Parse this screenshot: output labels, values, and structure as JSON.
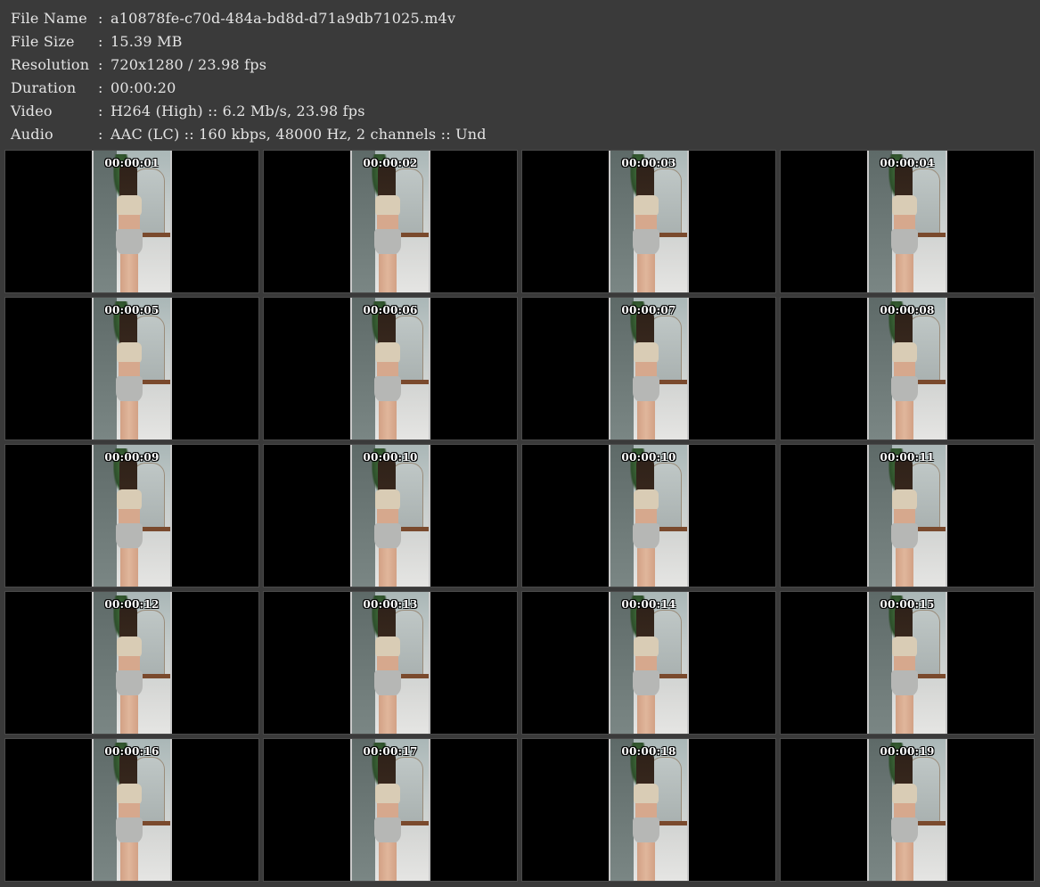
{
  "info": [
    {
      "label": "File Name",
      "value": "a10878fe-c70d-484a-bd8d-d71a9db71025.m4v"
    },
    {
      "label": "File Size",
      "value": "15.39 MB"
    },
    {
      "label": "Resolution",
      "value": "720x1280 / 23.98 fps"
    },
    {
      "label": "Duration",
      "value": "00:00:20"
    },
    {
      "label": "Video",
      "value": "H264 (High) :: 6.2 Mb/s, 23.98 fps"
    },
    {
      "label": "Audio",
      "value": "AAC (LC) :: 160 kbps, 48000 Hz, 2 channels :: Und"
    }
  ],
  "separator": ":",
  "thumbnails": [
    {
      "timestamp": "00:00:01"
    },
    {
      "timestamp": "00:00:02"
    },
    {
      "timestamp": "00:00:03"
    },
    {
      "timestamp": "00:00:04"
    },
    {
      "timestamp": "00:00:05"
    },
    {
      "timestamp": "00:00:06"
    },
    {
      "timestamp": "00:00:07"
    },
    {
      "timestamp": "00:00:08"
    },
    {
      "timestamp": "00:00:09"
    },
    {
      "timestamp": "00:00:10"
    },
    {
      "timestamp": "00:00:10"
    },
    {
      "timestamp": "00:00:11"
    },
    {
      "timestamp": "00:00:12"
    },
    {
      "timestamp": "00:00:13"
    },
    {
      "timestamp": "00:00:14"
    },
    {
      "timestamp": "00:00:15"
    },
    {
      "timestamp": "00:00:16"
    },
    {
      "timestamp": "00:00:17"
    },
    {
      "timestamp": "00:00:18"
    },
    {
      "timestamp": "00:00:19"
    }
  ]
}
